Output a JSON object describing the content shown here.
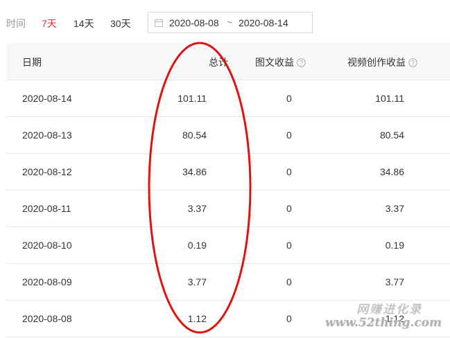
{
  "filter": {
    "label": "时间",
    "ranges": [
      {
        "label": "7天",
        "active": true
      },
      {
        "label": "14天",
        "active": false
      },
      {
        "label": "30天",
        "active": false
      }
    ],
    "date_range": {
      "start": "2020-08-08",
      "separator": "~",
      "end": "2020-08-14"
    }
  },
  "table": {
    "headers": {
      "date": "日期",
      "total": "总计",
      "graphic_income": "图文收益",
      "video_income": "视频创作收益"
    },
    "rows": [
      {
        "date": "2020-08-14",
        "total": "101.11",
        "graphic": "0",
        "video": "101.11"
      },
      {
        "date": "2020-08-13",
        "total": "80.54",
        "graphic": "0",
        "video": "80.54"
      },
      {
        "date": "2020-08-12",
        "total": "34.86",
        "graphic": "0",
        "video": "34.86"
      },
      {
        "date": "2020-08-11",
        "total": "3.37",
        "graphic": "0",
        "video": "3.37"
      },
      {
        "date": "2020-08-10",
        "total": "0.19",
        "graphic": "0",
        "video": "0.19"
      },
      {
        "date": "2020-08-09",
        "total": "3.77",
        "graphic": "0",
        "video": "3.77"
      },
      {
        "date": "2020-08-08",
        "total": "1.12",
        "graphic": "0",
        "video": "1.12"
      }
    ]
  },
  "annotation": {
    "color": "#e0120f"
  },
  "watermark": {
    "brand": "网赚进化录",
    "url": "www.52thing.com"
  },
  "colors": {
    "accent": "#e0322b",
    "header_bg": "#f7f8fa",
    "border": "#e8e8e8"
  }
}
